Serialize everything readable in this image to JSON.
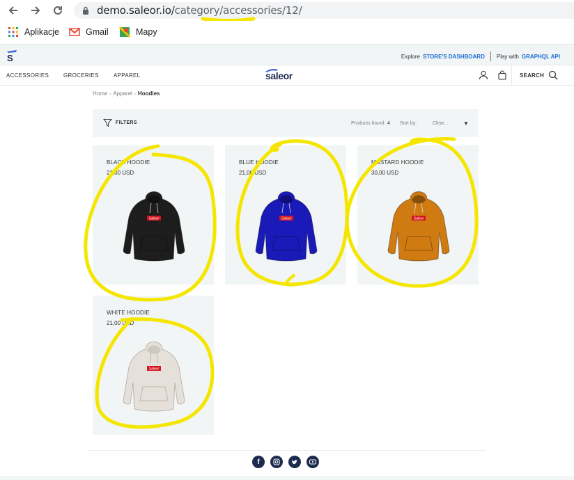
{
  "browser": {
    "url_host": "demo.saleor.io/",
    "url_path_a": "category/",
    "url_path_b": "accessories",
    "url_path_c": "/12/",
    "bookmarks": [
      {
        "label": "Aplikacje",
        "icon": "apps-grid-icon"
      },
      {
        "label": "Gmail",
        "icon": "gmail-icon"
      },
      {
        "label": "Mapy",
        "icon": "maps-icon"
      }
    ]
  },
  "topbar": {
    "explore_prefix": "Explore",
    "explore_link": "STORE'S DASHBOARD",
    "play_prefix": "Play with",
    "play_link": "GRAPHQL API"
  },
  "nav": {
    "items": [
      "ACCESSORIES",
      "GROCERIES",
      "APPAREL"
    ],
    "brand": "saleor",
    "search_label": "SEARCH"
  },
  "breadcrumb": {
    "home": "Home",
    "apparel": "Apparel",
    "current": "Hoodies"
  },
  "filters": {
    "label": "FILTERS",
    "found_label": "Products found:",
    "found_count": "4",
    "sort_label": "Sort by:",
    "sort_value": "Clear..."
  },
  "products": [
    {
      "name": "BLACK HOODIE",
      "price": "21,00 USD",
      "color": "#1d1d1d"
    },
    {
      "name": "BLUE HOODIE",
      "price": "21,00 USD",
      "color": "#1a1ab8"
    },
    {
      "name": "MUSTARD HOODIE",
      "price": "30,00 USD",
      "color": "#d07a12"
    },
    {
      "name": "WHITE HOODIE",
      "price": "21,00 USD",
      "color": "#e6e0db"
    }
  ],
  "hoodie_logo_text": "Saleor",
  "colors": {
    "annotation": "#f5e600",
    "brand_navy": "#1d2b4f",
    "card_bg": "#f1f5f5"
  },
  "footer": {
    "social_icons": [
      "facebook-icon",
      "instagram-icon",
      "twitter-icon",
      "youtube-icon"
    ]
  }
}
